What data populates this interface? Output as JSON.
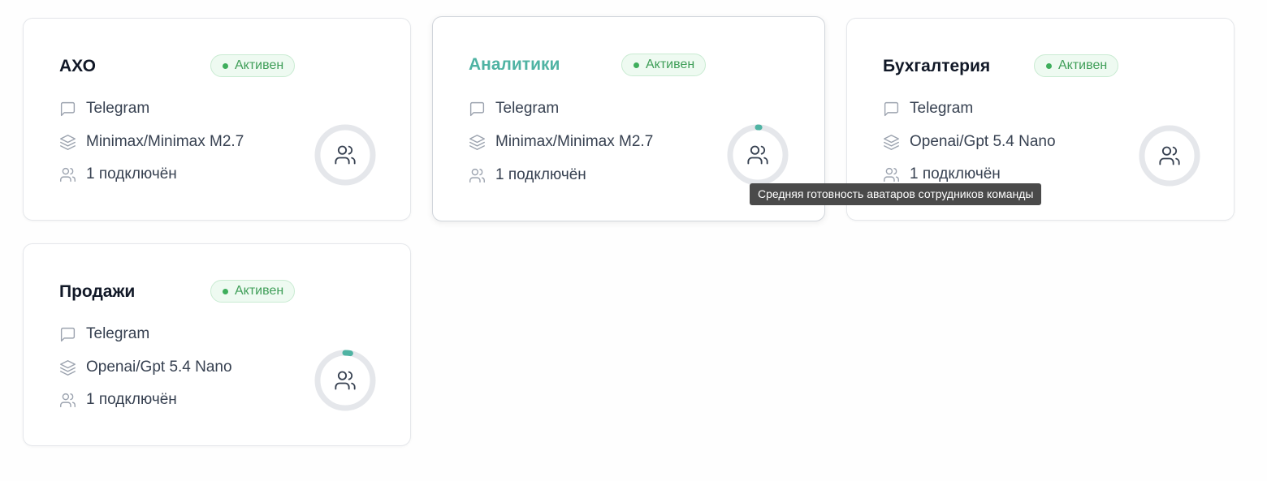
{
  "cards": [
    {
      "title": "АХО",
      "status": "Активен",
      "channel": "Telegram",
      "model": "Minimax/Minimax M2.7",
      "connected": "1 подключён",
      "readiness": 0
    },
    {
      "title": "Аналитики",
      "status": "Активен",
      "channel": "Telegram",
      "model": "Minimax/Minimax M2.7",
      "connected": "1 подключён",
      "readiness": 0.01
    },
    {
      "title": "Бухгалтерия",
      "status": "Активен",
      "channel": "Telegram",
      "model": "Openai/Gpt 5.4 Nano",
      "connected": "1 подключён",
      "readiness": 0
    },
    {
      "title": "Продажи",
      "status": "Активен",
      "channel": "Telegram",
      "model": "Openai/Gpt 5.4 Nano",
      "connected": "1 подключён",
      "readiness": 0.03
    }
  ],
  "tooltip": "Средняя готовность аватаров сотрудников команды",
  "colors": {
    "accent": "#4fb3a3",
    "ring_track": "#e5e7eb",
    "status_text": "#3f9e58",
    "status_bg": "#eefaf1"
  },
  "icons": {
    "channel": "message-square-icon",
    "model": "layers-icon",
    "connected": "users-icon",
    "ring_center": "users-icon"
  }
}
